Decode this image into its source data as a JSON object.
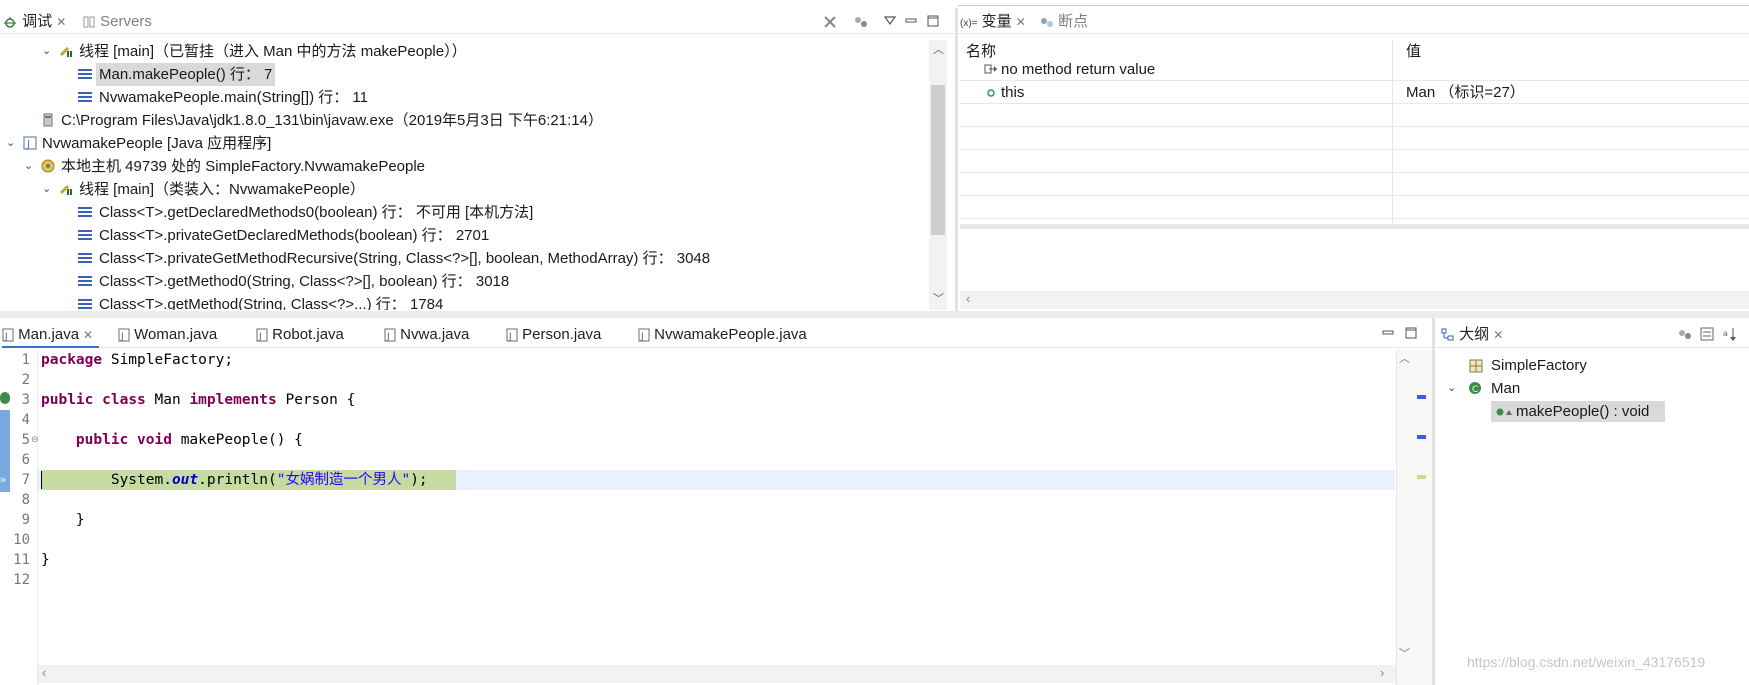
{
  "debug_panel": {
    "tabs": [
      {
        "label": "调试",
        "close": "✕"
      },
      {
        "label": "Servers"
      }
    ],
    "tree": [
      {
        "text": "线程 [main]（已暂挂（进入 Man 中的方法 makePeople））",
        "icon": "thread-suspended-icon",
        "expanded": true
      },
      {
        "text": "Man.makePeople() 行： 7",
        "icon": "stack-frame-icon",
        "selected": true
      },
      {
        "text": "NvwamakePeople.main(String[]) 行： 11",
        "icon": "stack-frame-icon"
      },
      {
        "text": "C:\\Program Files\\Java\\jdk1.8.0_131\\bin\\javaw.exe（2019年5月3日 下午6:21:14）",
        "icon": "process-icon"
      },
      {
        "text": "NvwamakePeople [Java 应用程序]",
        "icon": "launch-config-icon",
        "expanded": true
      },
      {
        "text": "本地主机 49739 处的 SimpleFactory.NvwamakePeople",
        "icon": "debug-target-icon",
        "expanded": true
      },
      {
        "text": "线程 [main]（类装入：NvwamakePeople）",
        "icon": "thread-suspended-icon",
        "expanded": true
      },
      {
        "text": "Class<T>.getDeclaredMethods0(boolean) 行： 不可用 [本机方法]",
        "icon": "stack-frame-icon"
      },
      {
        "text": "Class<T>.privateGetDeclaredMethods(boolean) 行： 2701",
        "icon": "stack-frame-icon"
      },
      {
        "text": "Class<T>.privateGetMethodRecursive(String, Class<?>[], boolean, MethodArray) 行： 3048",
        "icon": "stack-frame-icon"
      },
      {
        "text": "Class<T>.getMethod0(String, Class<?>[], boolean) 行： 3018",
        "icon": "stack-frame-icon"
      },
      {
        "text": "Class<T>.getMethod(String, Class<?>...) 行： 1784",
        "icon": "stack-frame-icon"
      }
    ]
  },
  "variables_panel": {
    "tabs": [
      {
        "label": "变量",
        "prefix": "(x)=",
        "close": "✕"
      },
      {
        "label": "断点"
      }
    ],
    "columns": [
      "名称",
      "值"
    ],
    "rows": [
      {
        "name": "no method return value",
        "value": "",
        "icon": "return-value-icon"
      },
      {
        "name": "this",
        "value": "Man  （标识=27）",
        "icon": "field-dot-icon"
      }
    ]
  },
  "editor": {
    "tabs": [
      {
        "label": "Man.java",
        "close": "✕",
        "active": true
      },
      {
        "label": "Woman.java"
      },
      {
        "label": "Robot.java"
      },
      {
        "label": "Nvwa.java"
      },
      {
        "label": "Person.java"
      },
      {
        "label": "NvwamakePeople.java"
      }
    ],
    "line_numbers": [
      "1",
      "2",
      "3",
      "4",
      "5",
      "6",
      "7",
      "8",
      "9",
      "10",
      "11",
      "12"
    ],
    "code": {
      "l1_kw": "package",
      "l1_rest": " SimpleFactory;",
      "l3_kw1": "public",
      "l3_kw2": "class",
      "l3_mid": " Man ",
      "l3_kw3": "implements",
      "l3_rest": " Person {",
      "l5_indent": "    ",
      "l5_kw1": "public",
      "l5_kw2": "void",
      "l5_rest": " makePeople() {",
      "l7_a": "        System.",
      "l7_field": "out",
      "l7_b": ".println(",
      "l7_str": "\"女娲制造一个男人\"",
      "l7_c": ");",
      "l9": "    }",
      "l11": "}"
    }
  },
  "outline_panel": {
    "tabs": [
      {
        "label": "大纲",
        "close": "✕"
      }
    ],
    "items": [
      {
        "text": "SimpleFactory",
        "icon": "package-decl-icon"
      },
      {
        "text": "Man",
        "icon": "class-icon",
        "expanded": true
      },
      {
        "text": "makePeople() : void",
        "icon": "public-method-icon",
        "selected": true
      }
    ]
  },
  "watermark": "https://blog.csdn.net/weixin_43176519",
  "colors": {
    "keyword": "#7f0055",
    "string": "#2a00ff",
    "field": "#0000c0",
    "current_line": "#c6dba2",
    "line_highlight": "#e8f2fe"
  }
}
